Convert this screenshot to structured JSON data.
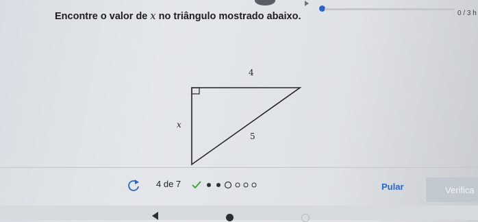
{
  "score": "0 / 3 h",
  "question": {
    "prefix": "Encontre o valor de ",
    "variable": "x",
    "suffix": " no triângulo mostrado abaixo."
  },
  "triangle": {
    "side_top": "4",
    "side_left": "x",
    "side_hyp": "5"
  },
  "footer": {
    "step": "4 de 7",
    "skip_label": "Pular",
    "check_label": "Verifica",
    "progress_steps": [
      "correct",
      "filled",
      "filled",
      "current",
      "empty",
      "empty",
      "empty"
    ]
  },
  "colors": {
    "accent": "#2a66c8",
    "correct": "#3a9d3a",
    "disabled_button": "#c2c8d0"
  },
  "icons": {
    "retry": "refresh-icon",
    "correct": "check-icon"
  }
}
